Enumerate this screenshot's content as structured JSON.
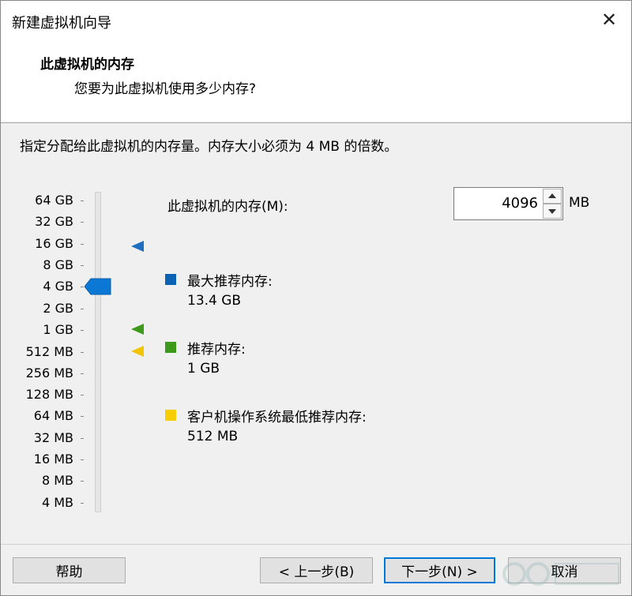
{
  "window": {
    "title": "新建虚拟机向导",
    "close_glyph": "✕"
  },
  "header": {
    "title": "此虚拟机的内存",
    "subtitle": "您要为此虚拟机使用多少内存?"
  },
  "instruction": "指定分配给此虚拟机的内存量。内存大小必须为 4 MB 的倍数。",
  "memory_scale": {
    "labels": [
      "64 GB",
      "32 GB",
      "16 GB",
      "8 GB",
      "4 GB",
      "2 GB",
      "1 GB",
      "512 MB",
      "256 MB",
      "128 MB",
      "64 MB",
      "32 MB",
      "16 MB",
      "8 MB",
      "4 MB"
    ],
    "slider_value": "4 GB",
    "markers": [
      {
        "name": "max-recommended-marker",
        "value": "16 GB",
        "color": "#1e6fbf"
      },
      {
        "name": "recommended-marker",
        "value": "1 GB",
        "color": "#3d9a1b"
      },
      {
        "name": "guest-min-marker",
        "value": "512 MB",
        "color": "#f2c500"
      }
    ]
  },
  "memory_input": {
    "label": "此虚拟机的内存(M):",
    "value": "4096",
    "unit": "MB"
  },
  "legend": [
    {
      "name": "max-recommended",
      "label": "最大推荐内存:",
      "value": "13.4 GB",
      "color": "#0c63b4"
    },
    {
      "name": "recommended",
      "label": "推荐内存:",
      "value": "1 GB",
      "color": "#3c9a1a"
    },
    {
      "name": "guest-min",
      "label": "客户机操作系统最低推荐内存:",
      "value": "512 MB",
      "color": "#f7cf00"
    }
  ],
  "buttons": {
    "help": "帮助",
    "back": "< 上一步(B)",
    "next": "下一步(N) >",
    "cancel": "取消"
  },
  "colors": {
    "accent": "#0078d7",
    "thumb": "#0a78d4"
  }
}
